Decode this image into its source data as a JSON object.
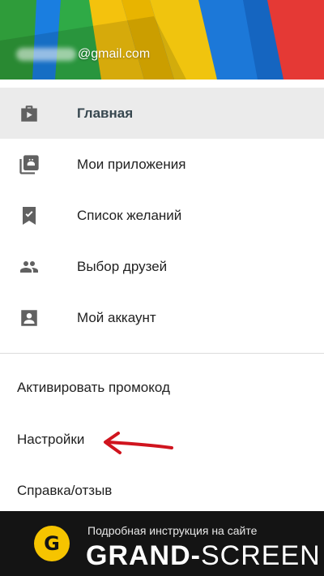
{
  "account": {
    "email_suffix": "@gmail.com"
  },
  "menu": {
    "items": [
      {
        "label": "Главная",
        "icon": "shop-icon",
        "active": true
      },
      {
        "label": "Мои приложения",
        "icon": "my-apps-icon",
        "active": false
      },
      {
        "label": "Список желаний",
        "icon": "wishlist-icon",
        "active": false
      },
      {
        "label": "Выбор друзей",
        "icon": "people-icon",
        "active": false
      },
      {
        "label": "Мой аккаунт",
        "icon": "account-icon",
        "active": false
      }
    ],
    "secondary": [
      {
        "label": "Активировать промокод"
      },
      {
        "label": "Настройки"
      },
      {
        "label": "Справка/отзыв"
      }
    ]
  },
  "annotation": {
    "arrow_color": "#d0141e",
    "arrow_target": "Настройки"
  },
  "banner": {
    "logo_letter": "G",
    "subtitle": "Подробная инструкция на сайте",
    "brand_bold": "GRAND-",
    "brand_regular": "SCREEN"
  },
  "colors": {
    "active_bg": "#ebebeb",
    "icon": "#616161",
    "banner_bg": "#141414",
    "logo": "#f6c400"
  }
}
